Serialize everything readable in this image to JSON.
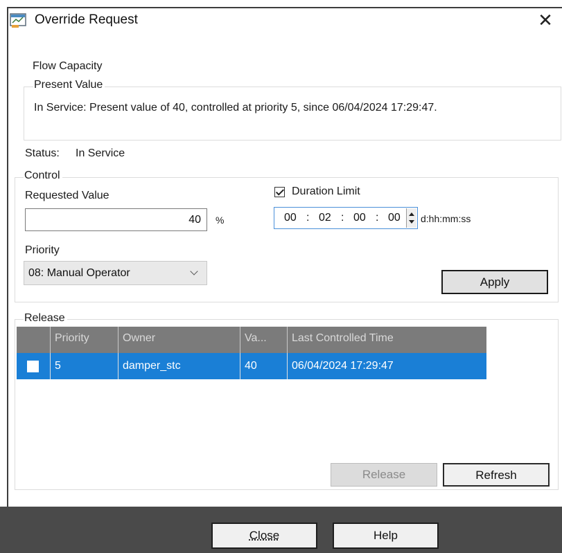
{
  "window": {
    "title": "Override Request",
    "icon": "app-window-icon",
    "close_glyph": "✕"
  },
  "object_name": "Flow Capacity",
  "present_value": {
    "legend": "Present Value",
    "text": "In Service: Present value of 40, controlled at priority 5, since 06/04/2024 17:29:47."
  },
  "status": {
    "label": "Status:",
    "value": "In Service"
  },
  "control": {
    "legend": "Control",
    "requested_value_label": "Requested Value",
    "requested_value": "40",
    "unit": "%",
    "duration_limit_label": "Duration Limit",
    "duration_limit_checked": true,
    "duration": {
      "days": "00",
      "hours": "02",
      "minutes": "00",
      "seconds": "00",
      "sep": ":",
      "format_hint": "d:hh:mm:ss"
    },
    "priority_label": "Priority",
    "priority_selected": "08: Manual Operator",
    "apply_label": "Apply"
  },
  "release": {
    "legend": "Release",
    "columns": [
      "Priority",
      "Owner",
      "Va...",
      "Last Controlled Time"
    ],
    "rows": [
      {
        "checked": false,
        "priority": "5",
        "owner": "damper_stc",
        "value": "40",
        "last_controlled": "06/04/2024 17:29:47"
      }
    ],
    "release_label": "Release",
    "refresh_label": "Refresh"
  },
  "footer": {
    "close_label": "Close",
    "help_label": "Help"
  },
  "colors": {
    "selection": "#1a7fd6",
    "grid_header": "#7b7b7b",
    "footer_bg": "#4a4a4a"
  }
}
